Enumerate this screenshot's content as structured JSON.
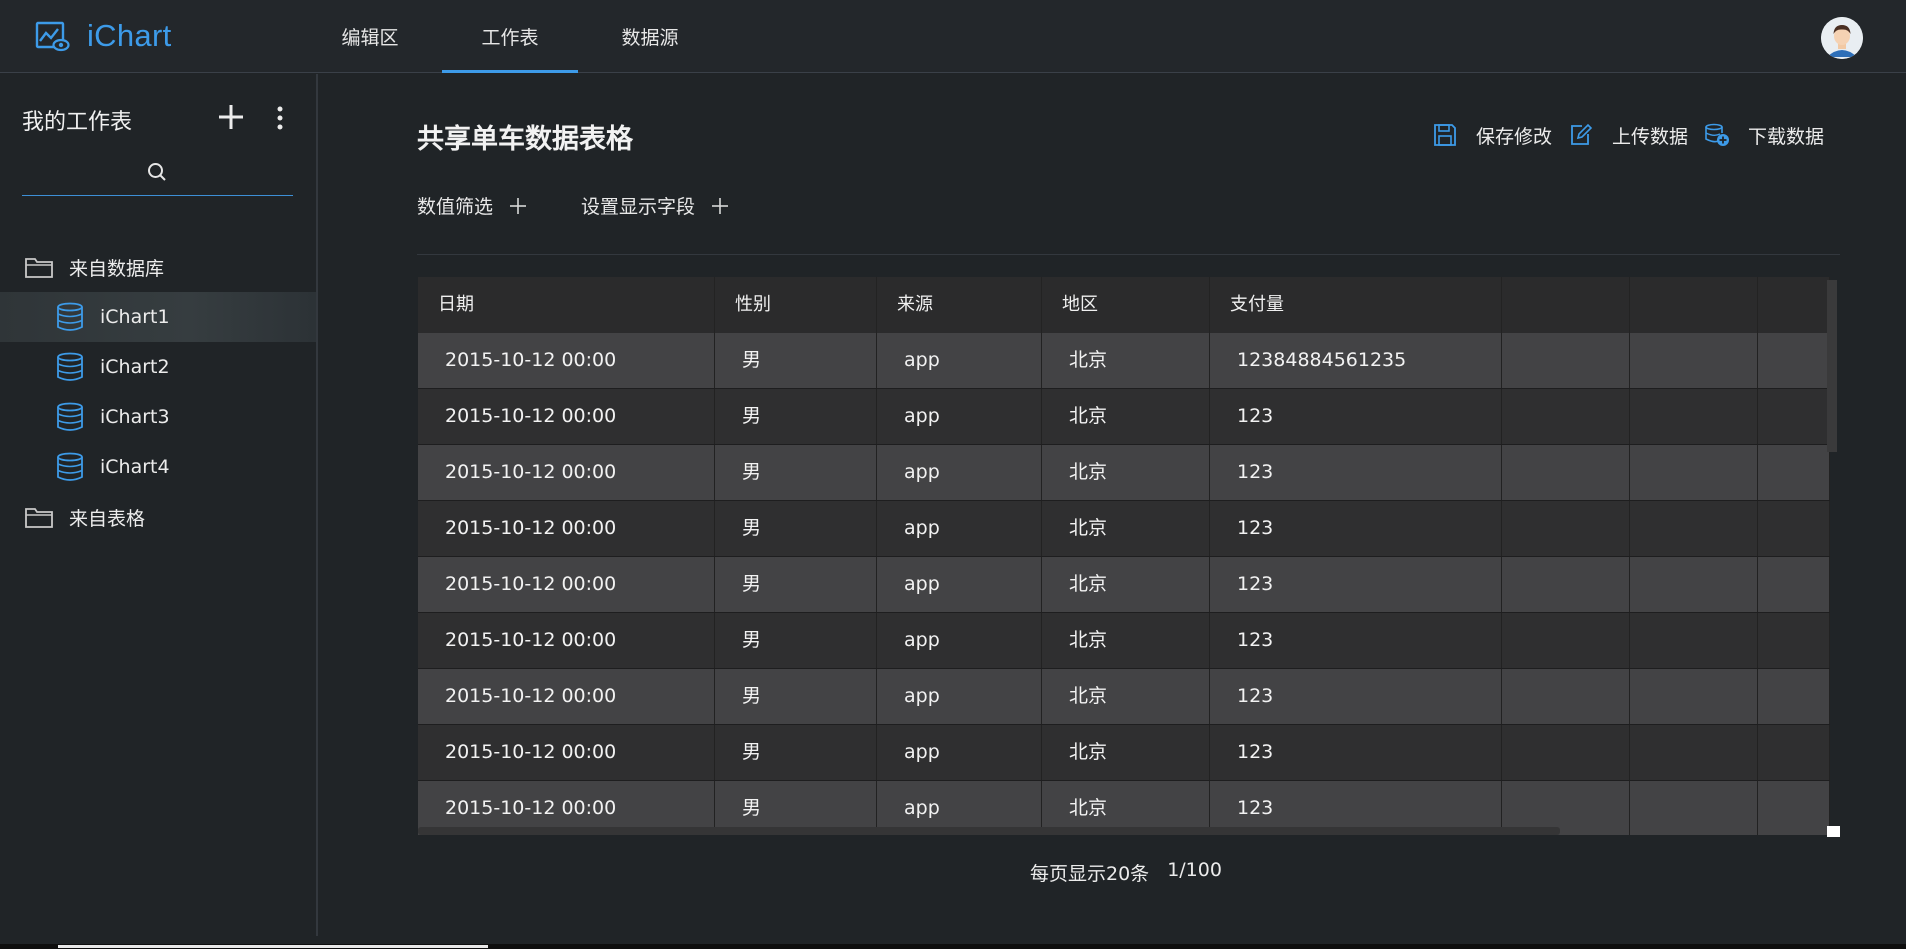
{
  "app": {
    "name": "iChart"
  },
  "nav": {
    "tabs": [
      "编辑区",
      "工作表",
      "数据源"
    ],
    "active_index": 1
  },
  "sidebar": {
    "title": "我的工作表",
    "search": {
      "placeholder": ""
    },
    "tree": [
      {
        "type": "folder",
        "label": "来自数据库"
      },
      {
        "type": "leaf",
        "label": "iChart1",
        "selected": true
      },
      {
        "type": "leaf",
        "label": "iChart2"
      },
      {
        "type": "leaf",
        "label": "iChart3"
      },
      {
        "type": "leaf",
        "label": "iChart4"
      },
      {
        "type": "folder",
        "label": "来自表格"
      }
    ]
  },
  "main": {
    "title": "共享单车数据表格",
    "actions": {
      "save": "保存修改",
      "upload": "上传数据",
      "download": "下载数据"
    },
    "filters": {
      "value_filter": "数值筛选",
      "display_fields": "设置显示字段"
    }
  },
  "table": {
    "columns": [
      "日期",
      "性别",
      "来源",
      "地区",
      "支付量",
      "",
      "",
      ""
    ],
    "rows": [
      [
        "2015-10-12 00:00",
        "男",
        "app",
        "北京",
        "12384884561235",
        "",
        "",
        ""
      ],
      [
        "2015-10-12 00:00",
        "男",
        "app",
        "北京",
        "123",
        "",
        "",
        ""
      ],
      [
        "2015-10-12 00:00",
        "男",
        "app",
        "北京",
        "123",
        "",
        "",
        ""
      ],
      [
        "2015-10-12 00:00",
        "男",
        "app",
        "北京",
        "123",
        "",
        "",
        ""
      ],
      [
        "2015-10-12 00:00",
        "男",
        "app",
        "北京",
        "123",
        "",
        "",
        ""
      ],
      [
        "2015-10-12 00:00",
        "男",
        "app",
        "北京",
        "123",
        "",
        "",
        ""
      ],
      [
        "2015-10-12 00:00",
        "男",
        "app",
        "北京",
        "123",
        "",
        "",
        ""
      ],
      [
        "2015-10-12 00:00",
        "男",
        "app",
        "北京",
        "123",
        "",
        "",
        ""
      ],
      [
        "2015-10-12 00:00",
        "男",
        "app",
        "北京",
        "123",
        "",
        "",
        ""
      ]
    ]
  },
  "pager": {
    "per_page": "每页显示20条",
    "page": "1/100"
  },
  "colors": {
    "accent": "#3d9be9",
    "background": "#202427",
    "row_odd": "#434345",
    "row_even": "#2f2f30"
  }
}
